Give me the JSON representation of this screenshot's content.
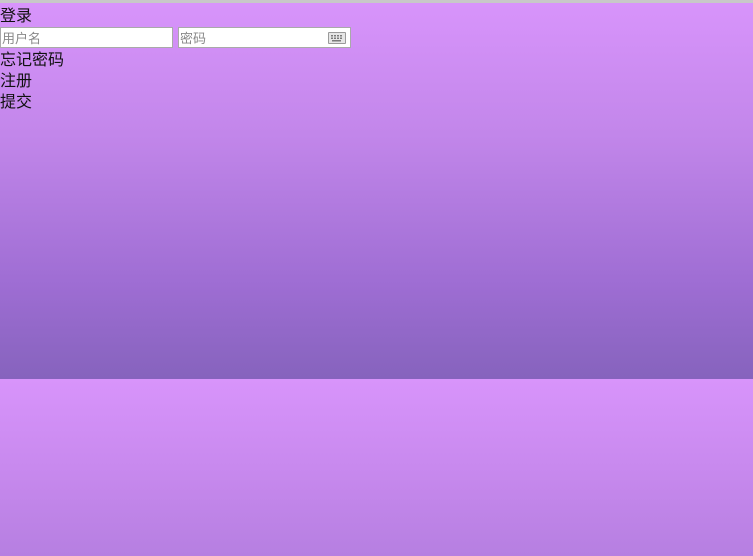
{
  "login": {
    "title": "登录",
    "username_placeholder": "用户名",
    "password_placeholder": "密码",
    "keyboard_icon": "keyboard-icon",
    "forgot_password": "忘记密码",
    "register": "注册",
    "submit": "提交"
  },
  "colors": {
    "background_top": "#d894fb",
    "background_bottom": "#8663bd"
  }
}
